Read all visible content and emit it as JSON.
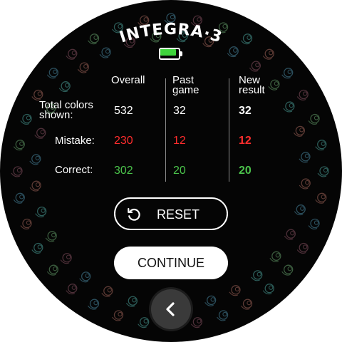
{
  "app": {
    "title": "INTEGRA·3"
  },
  "battery": {
    "icon": "battery-icon",
    "color": "#3fd43c"
  },
  "stats": {
    "headers": {
      "overall": "Overall",
      "past_game": "Past\ngame",
      "new_result": "New\nresult"
    },
    "rows": [
      {
        "label": "Total colors\nshown:",
        "overall": "532",
        "past": "32",
        "new": "32",
        "color": "#ffffff"
      },
      {
        "label": "Mistake:",
        "overall": "230",
        "past": "12",
        "new": "12",
        "color": "#ff2d2d"
      },
      {
        "label": "Correct:",
        "overall": "302",
        "past": "20",
        "new": "20",
        "color": "#4bc24b"
      }
    ]
  },
  "buttons": {
    "reset_label": "RESET",
    "reset_icon": "reset-icon",
    "continue_label": "CONTINUE",
    "back_icon": "chevron-left-icon"
  },
  "ring": {
    "colors": [
      "#2c5c58",
      "#5c3a34",
      "#2b4e5c",
      "#4d2f38",
      "#3b5c3e"
    ]
  }
}
